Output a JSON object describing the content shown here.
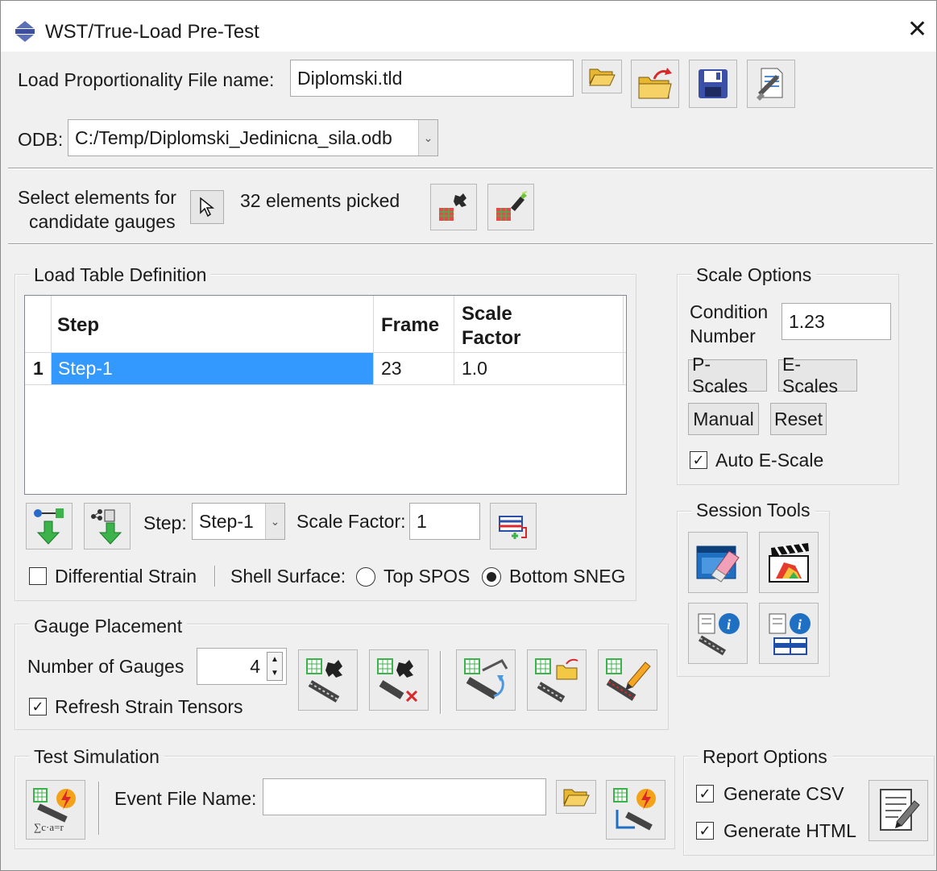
{
  "window": {
    "title": "WST/True-Load Pre-Test",
    "close_symbol": "✕"
  },
  "file": {
    "label": "Load Proportionality File name:",
    "value": "Diplomski.tld"
  },
  "odb": {
    "label": "ODB:",
    "value": "C:/Temp/Diplomski_Jedinicna_sila.odb"
  },
  "select": {
    "label_line1": "Select elements for",
    "label_line2": "candidate gauges",
    "status": "32 elements picked"
  },
  "load_table": {
    "title": "Load Table Definition",
    "headers": {
      "step": "Step",
      "frame": "Frame",
      "scale_line1": "Scale",
      "scale_line2": "Factor"
    },
    "rows": [
      {
        "index": "1",
        "step": "Step-1",
        "frame": "23",
        "scale": "1.0"
      }
    ],
    "step_label": "Step:",
    "step_value": "Step-1",
    "scale_factor_label": "Scale Factor:",
    "scale_factor_value": "1",
    "differential_strain": {
      "label": "Differential Strain",
      "checked": false
    },
    "shell_surface_label": "Shell Surface:",
    "shell_options": [
      {
        "label": "Top SPOS",
        "selected": false
      },
      {
        "label": "Bottom SNEG",
        "selected": true
      }
    ]
  },
  "scale_options": {
    "title": "Scale Options",
    "condition_label_line1": "Condition",
    "condition_label_line2": "Number",
    "condition_value": "1.23",
    "p_scales": "P-Scales",
    "e_scales": "E-Scales",
    "manual": "Manual",
    "reset": "Reset",
    "auto_escale": {
      "label": "Auto E-Scale",
      "checked": true
    }
  },
  "session_tools": {
    "title": "Session Tools"
  },
  "gauge_placement": {
    "title": "Gauge Placement",
    "number_label": "Number of Gauges",
    "number_value": "4",
    "refresh": {
      "label": "Refresh Strain Tensors",
      "checked": true
    }
  },
  "test_simulation": {
    "title": "Test Simulation",
    "event_label": "Event File Name:",
    "event_value": ""
  },
  "report_options": {
    "title": "Report Options",
    "csv": {
      "label": "Generate CSV",
      "checked": true
    },
    "html": {
      "label": "Generate HTML",
      "checked": true
    }
  },
  "colors": {
    "selection": "#3399ff",
    "window_bg": "#f0f0f0",
    "folder_yellow": "#f3c845",
    "accent_blue": "#1f6fc2"
  },
  "icons": [
    "app-icon",
    "open-folder-icon",
    "export-folder-icon",
    "save-disk-icon",
    "clear-settings-icon",
    "pick-arrow-icon",
    "element-cloud-icon",
    "element-highlight-icon",
    "add-step-icon",
    "add-all-steps-icon",
    "table-add-icon",
    "eraser-window-icon",
    "movie-clapper-icon",
    "gauge-info-icon",
    "table-info-icon",
    "gauge-place-icon",
    "gauge-remove-icon",
    "gauge-rotate-icon",
    "gauge-export-icon",
    "gauge-edit-icon",
    "simulate-sum-icon",
    "simulate-axes-icon",
    "report-edit-icon"
  ]
}
